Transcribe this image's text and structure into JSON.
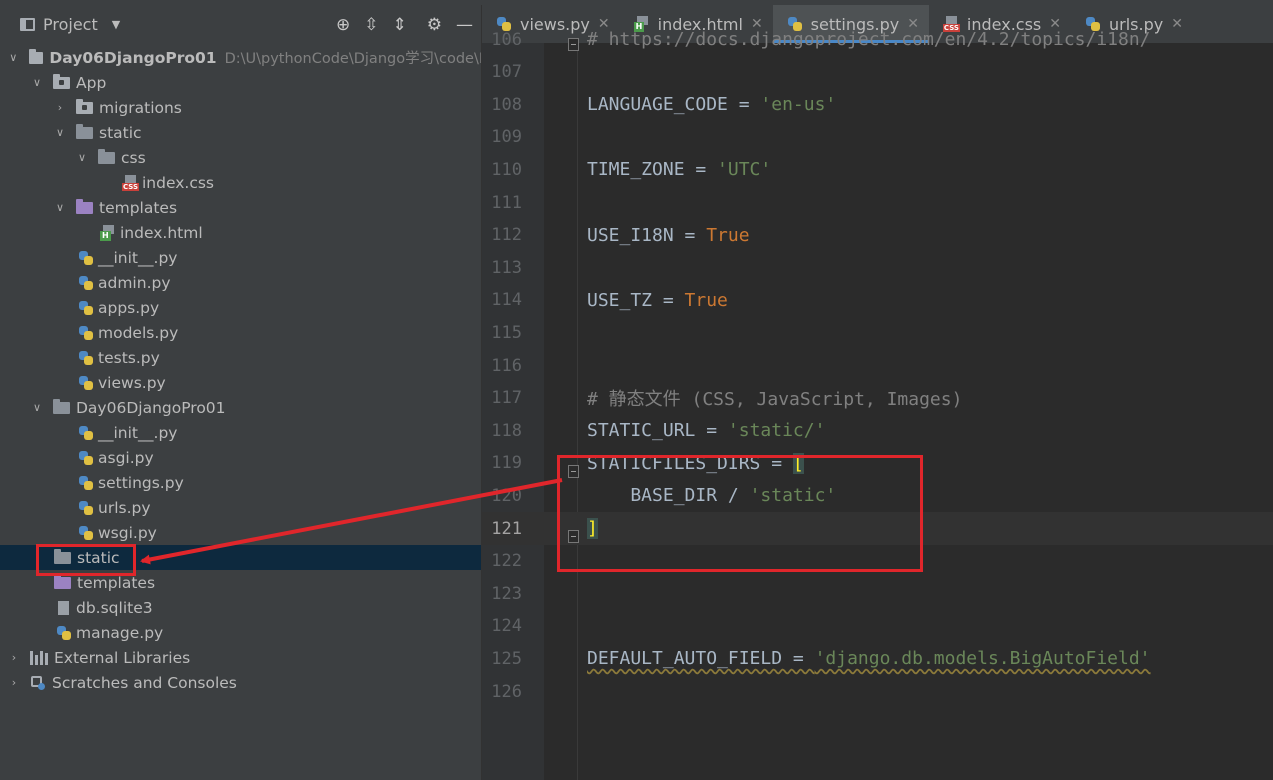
{
  "project_panel": {
    "title": "Project",
    "tree": [
      {
        "label": "Day06DjangoPro01",
        "path": "D:\\U\\pythonCode\\Django学习\\code\\D"
      },
      {
        "label": "App"
      },
      {
        "label": "migrations"
      },
      {
        "label": "static"
      },
      {
        "label": "css"
      },
      {
        "label": "index.css"
      },
      {
        "label": "templates"
      },
      {
        "label": "index.html"
      },
      {
        "label": "__init__.py"
      },
      {
        "label": "admin.py"
      },
      {
        "label": "apps.py"
      },
      {
        "label": "models.py"
      },
      {
        "label": "tests.py"
      },
      {
        "label": "views.py"
      },
      {
        "label": "Day06DjangoPro01"
      },
      {
        "label": "__init__.py"
      },
      {
        "label": "asgi.py"
      },
      {
        "label": "settings.py"
      },
      {
        "label": "urls.py"
      },
      {
        "label": "wsgi.py"
      },
      {
        "label": "static"
      },
      {
        "label": "templates"
      },
      {
        "label": "db.sqlite3"
      },
      {
        "label": "manage.py"
      },
      {
        "label": "External Libraries"
      },
      {
        "label": "Scratches and Consoles"
      }
    ]
  },
  "tabs": [
    {
      "label": "views.py"
    },
    {
      "label": "index.html"
    },
    {
      "label": "settings.py"
    },
    {
      "label": "index.css"
    },
    {
      "label": "urls.py"
    }
  ],
  "editor": {
    "lines": [
      {
        "n": "106",
        "code": [
          {
            "t": "# https://docs.djangoproject.com/en/4.2/topics/i18n/",
            "c": "com"
          }
        ]
      },
      {
        "n": "107",
        "code": []
      },
      {
        "n": "108",
        "code": [
          {
            "t": "LANGUAGE_CODE = ",
            "c": ""
          },
          {
            "t": "'en-us'",
            "c": "str"
          }
        ]
      },
      {
        "n": "109",
        "code": []
      },
      {
        "n": "110",
        "code": [
          {
            "t": "TIME_ZONE = ",
            "c": ""
          },
          {
            "t": "'UTC'",
            "c": "str"
          }
        ]
      },
      {
        "n": "111",
        "code": []
      },
      {
        "n": "112",
        "code": [
          {
            "t": "USE_I18N = ",
            "c": ""
          },
          {
            "t": "True",
            "c": "kw"
          }
        ]
      },
      {
        "n": "113",
        "code": []
      },
      {
        "n": "114",
        "code": [
          {
            "t": "USE_TZ = ",
            "c": ""
          },
          {
            "t": "True",
            "c": "kw"
          }
        ]
      },
      {
        "n": "115",
        "code": []
      },
      {
        "n": "116",
        "code": []
      },
      {
        "n": "117",
        "code": [
          {
            "t": "# 静态文件 (CSS, JavaScript, Images)",
            "c": "com"
          }
        ]
      },
      {
        "n": "118",
        "code": [
          {
            "t": "STATIC_URL = ",
            "c": ""
          },
          {
            "t": "'static/'",
            "c": "str"
          }
        ]
      },
      {
        "n": "119",
        "code": [
          {
            "t": "STATICFILES_DIRS = ",
            "c": ""
          },
          {
            "t": "[",
            "c": "bracket-hl"
          }
        ]
      },
      {
        "n": "120",
        "code": [
          {
            "t": "    BASE_DIR / ",
            "c": ""
          },
          {
            "t": "'static'",
            "c": "str"
          }
        ]
      },
      {
        "n": "121",
        "code": [
          {
            "t": "]",
            "c": "bracket-hl"
          }
        ]
      },
      {
        "n": "122",
        "code": []
      },
      {
        "n": "123",
        "code": []
      },
      {
        "n": "124",
        "code": []
      },
      {
        "n": "125",
        "code": [
          {
            "t": "DEFAULT_AUTO_FIELD = ",
            "c": "warn-underline"
          },
          {
            "t": "'django.db.models.BigAutoField'",
            "c": "str warn-underline"
          }
        ]
      },
      {
        "n": "126",
        "code": []
      }
    ]
  },
  "annotation": {
    "color": "#e0262b"
  }
}
